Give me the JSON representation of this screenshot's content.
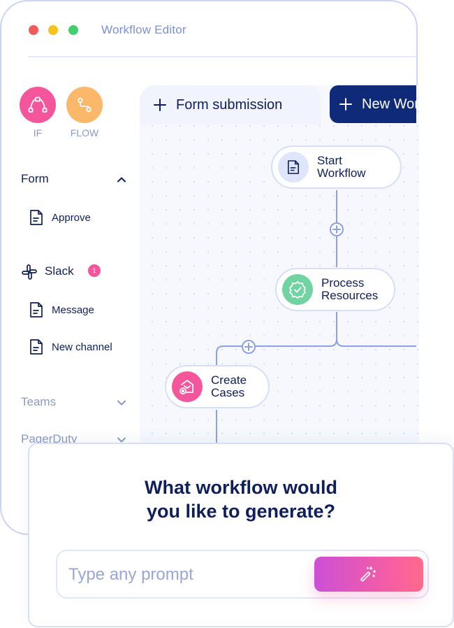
{
  "window": {
    "title": "Workflow Editor"
  },
  "sidebar": {
    "actions": [
      {
        "label": "IF",
        "icon": "bezier-curve-icon",
        "color": "#f5559b"
      },
      {
        "label": "FLOW",
        "icon": "route-icon",
        "color": "#fbb86b"
      }
    ],
    "sections": [
      {
        "label": "Form",
        "expanded": true,
        "items": [
          {
            "label": "Approve",
            "icon": "document-icon"
          }
        ]
      },
      {
        "label": "Slack",
        "badge": "1",
        "expanded": true,
        "items": [
          {
            "label": "Message",
            "icon": "document-icon"
          },
          {
            "label": "New channel",
            "icon": "document-icon"
          }
        ]
      },
      {
        "label": "Teams",
        "expanded": false
      },
      {
        "label": "PagerDuty",
        "expanded": false
      }
    ]
  },
  "tabs": {
    "active": {
      "label": "Form submission"
    },
    "new": {
      "label": "New Workflow"
    }
  },
  "nodes": {
    "start": {
      "label": "Start\nWorkflow",
      "color": "#dfe5fb"
    },
    "process": {
      "label": "Process\nResources",
      "color": "#6fd4a2"
    },
    "create": {
      "label": "Create\nCases",
      "color": "#f5559b"
    }
  },
  "prompt": {
    "question": "What workflow would\nyou like to generate?",
    "placeholder": "Type any prompt",
    "button_icon": "magic-wand-icon"
  },
  "colors": {
    "navy": "#0f1f5c",
    "accent_blue": "#102a7a",
    "pink": "#f5559b",
    "orange": "#fbb86b",
    "green": "#6fd4a2"
  }
}
